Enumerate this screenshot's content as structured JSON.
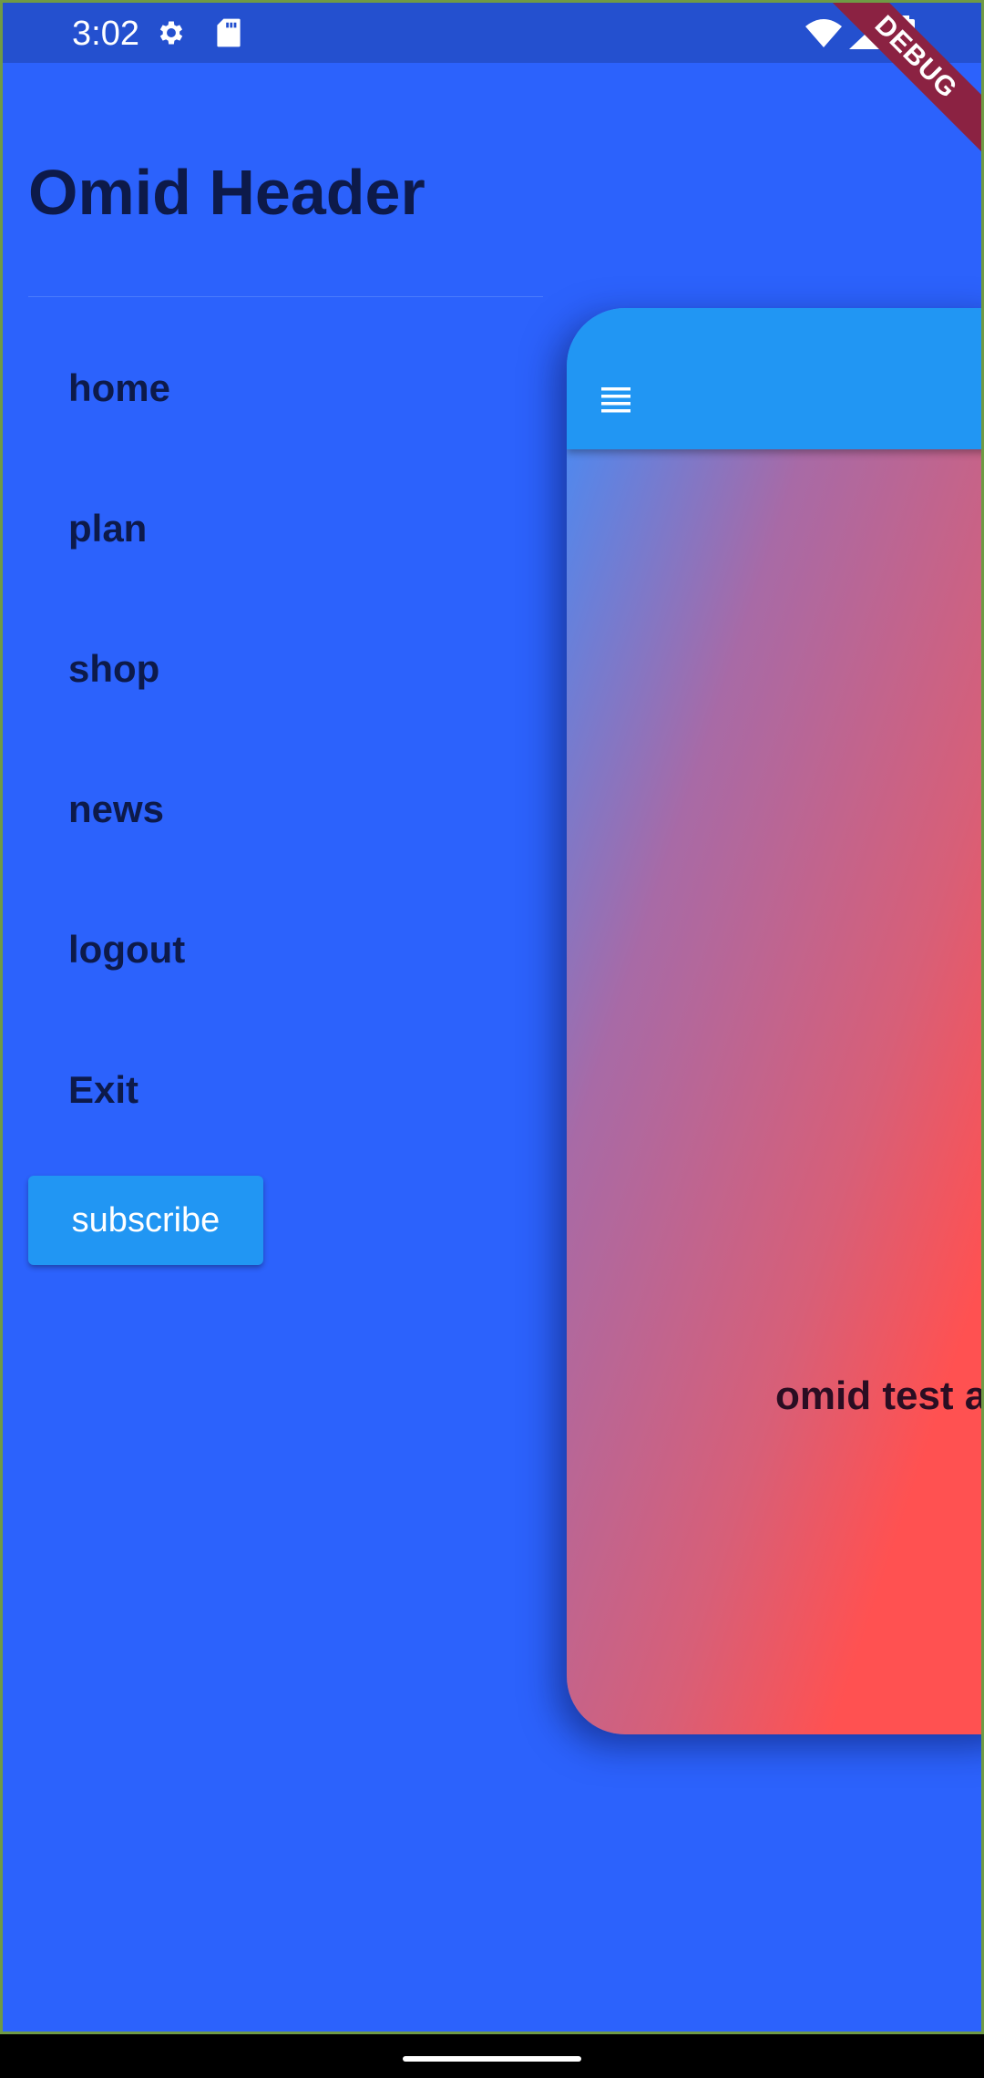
{
  "status_bar": {
    "time": "3:02",
    "icons": [
      "gear-icon",
      "sdcard-icon",
      "wifi-icon",
      "signal-icon",
      "battery-icon"
    ]
  },
  "debug_banner": {
    "label": "DEBUG"
  },
  "drawer": {
    "title": "Omid Header",
    "items": [
      {
        "label": "home"
      },
      {
        "label": "plan"
      },
      {
        "label": "shop"
      },
      {
        "label": "news"
      },
      {
        "label": "logout"
      },
      {
        "label": "Exit"
      }
    ],
    "subscribe_label": "subscribe"
  },
  "main": {
    "body_text": "omid test a",
    "menu_icon": "menu-icon"
  },
  "colors": {
    "background": "#2c62fc",
    "status_bar": "#2450cf",
    "app_bar": "#2196f3",
    "gradient_start": "#3f8efc",
    "gradient_end": "#ff5151",
    "text_dark": "#0d1a4a",
    "debug_banner": "#8b2242"
  }
}
